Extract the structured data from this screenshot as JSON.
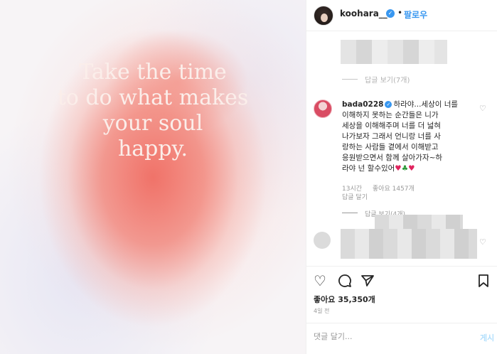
{
  "image": {
    "quote_lines": [
      "Take the time",
      "to do what makes",
      "your soul",
      "happy."
    ]
  },
  "header": {
    "username": "koohara__",
    "separator": "•",
    "follow_label": "팔로우"
  },
  "faded": {
    "top_replies": "답글 보기(7개)",
    "mid_replies": "답글 보기(4개)"
  },
  "comment": {
    "username": "bada0228",
    "lines": [
      "하라야...세상이 너를",
      "이해하지 못하는 순간들은 니가",
      "세상을 이해해주며 너를 더 넓혀",
      "나가보자 그래서 언니랑 너를 사",
      "랑하는 사람들 곁에서 이해받고",
      "응원받으면서 함께 살아가자~하",
      "라야 넌 할수있어"
    ],
    "emojis": [
      "♥",
      "♣",
      "♥"
    ],
    "time": "13시간",
    "likes": "좋아요 1457개",
    "reply": "답글 달기"
  },
  "post": {
    "likes_label": "좋아요 35,350개",
    "time_ago": "4일 전",
    "comment_placeholder": "댓글 달기...",
    "post_label": "게시"
  },
  "icons": {
    "like": "heart-icon",
    "comment": "comment-icon",
    "share": "share-icon",
    "save": "bookmark-icon"
  },
  "colors": {
    "accent": "#3897f0",
    "text": "#262626",
    "muted": "#999999"
  }
}
